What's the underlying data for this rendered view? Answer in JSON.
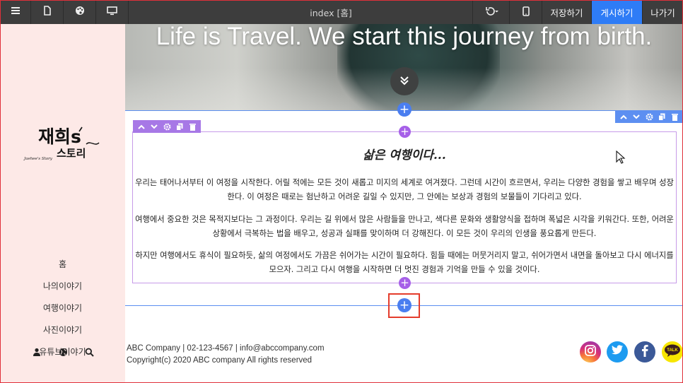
{
  "toolbar": {
    "title": "index [홈]",
    "save_label": "저장하기",
    "publish_label": "게시하기",
    "exit_label": "나가기",
    "icons": [
      "menu-icon",
      "page-icon",
      "palette-icon",
      "desktop-icon",
      "undo-icon",
      "mobile-icon"
    ]
  },
  "brand": {
    "logo_text_main": "재희s",
    "logo_text_sub": "스토리",
    "logo_caption": "Jaehee's Story"
  },
  "sidebar": {
    "items": [
      {
        "label": "홈"
      },
      {
        "label": "나의이야기"
      },
      {
        "label": "여행이야기"
      },
      {
        "label": "사진이야기"
      },
      {
        "label": "유튜브이야기"
      }
    ],
    "icons": [
      "user-icon",
      "globe-icon",
      "search-icon"
    ]
  },
  "hero": {
    "title": "Life is Travel. We start this journey from birth."
  },
  "content": {
    "title": "삶은 여행이다...",
    "paragraphs": [
      "우리는 태어나서부터 이 여정을 시작한다. 어릴 적에는 모든 것이 새롭고 미지의 세계로 여겨졌다. 그런데 시간이 흐르면서, 우리는 다양한 경험을 쌓고 배우며 성장한다. 이 여정은 때로는 험난하고 어려운 길일 수 있지만, 그 안에는 보상과 경험의 보물들이 기다리고 있다.",
      "여행에서 중요한 것은 목적지보다는 그 과정이다. 우리는 길 위에서 많은 사람들을 만나고, 색다른 문화와 생활양식을 접하며 폭넓은 시각을 키워간다. 또한, 어려운 상황에서 극복하는 법을 배우고, 성공과 실패를 맞이하며 더 강해진다. 이 모든 것이 우리의 인생을 풍요롭게 만든다.",
      "하지만 여행에서도 휴식이 필요하듯, 삶의 여정에서도 가끔은 쉬어가는 시간이 필요하다. 힘들 때에는 머뭇거리지 말고, 쉬어가면서 내면을 돌아보고 다시 에너지를 모으자. 그리고 다시 여행을 시작하면 더 멋진 경험과 기억을 만들 수 있을 것이다."
    ]
  },
  "footer": {
    "line1": "ABC Company | 02-123-4567 | info@abccompany.com",
    "line2": "Copyright(c) 2020 ABC company All rights reserved",
    "social": [
      {
        "name": "instagram-icon",
        "color": "#d6307a"
      },
      {
        "name": "twitter-icon",
        "color": "#1d9bf0"
      },
      {
        "name": "facebook-icon",
        "color": "#3b5998"
      },
      {
        "name": "kakaotalk-icon",
        "color": "#f7e600",
        "label": "TALK"
      }
    ]
  },
  "colors": {
    "toolbar_bg": "#3d3d3d",
    "publish_accent": "#2e7cf6",
    "sidebar_bg": "#fde9e7",
    "section_blue": "#5a8ef0",
    "block_purple": "#a778e6"
  }
}
